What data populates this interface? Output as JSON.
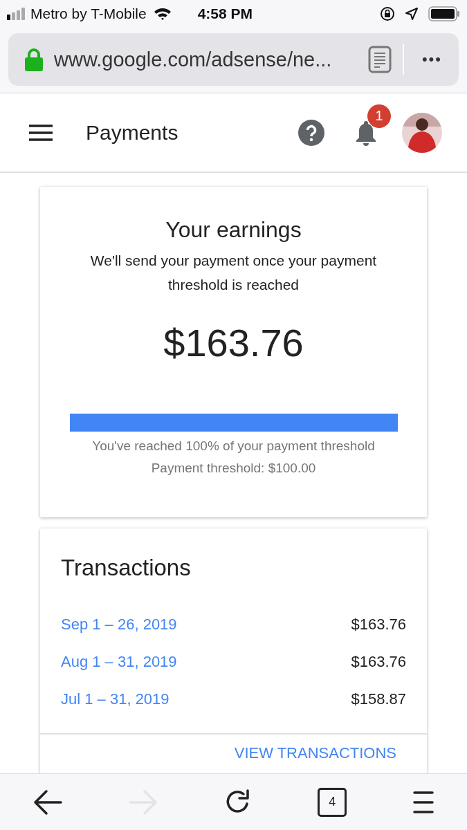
{
  "status_bar": {
    "carrier": "Metro by T-Mobile",
    "time": "4:58 PM"
  },
  "browser": {
    "url": "www.google.com/adsense/ne...",
    "more": "•••"
  },
  "header": {
    "title": "Payments",
    "notifications": "1"
  },
  "earnings": {
    "title": "Your earnings",
    "subtitle": "We'll send your payment once your payment threshold is reached",
    "amount": "$163.76",
    "progress": {
      "level": 1
    },
    "reached": "You've reached 100% of your payment threshold",
    "threshold": "Payment threshold: $100.00"
  },
  "transactions": {
    "title": "Transactions",
    "rows": [
      {
        "period": "Sep 1 – 26, 2019",
        "amount": "$163.76"
      },
      {
        "period": "Aug 1 – 31, 2019",
        "amount": "$163.76"
      },
      {
        "period": "Jul 1 – 31, 2019",
        "amount": "$158.87"
      }
    ],
    "action": "VIEW TRANSACTIONS"
  },
  "toolbar": {
    "forward": {
      "disabled": true
    },
    "tabs": "4"
  }
}
